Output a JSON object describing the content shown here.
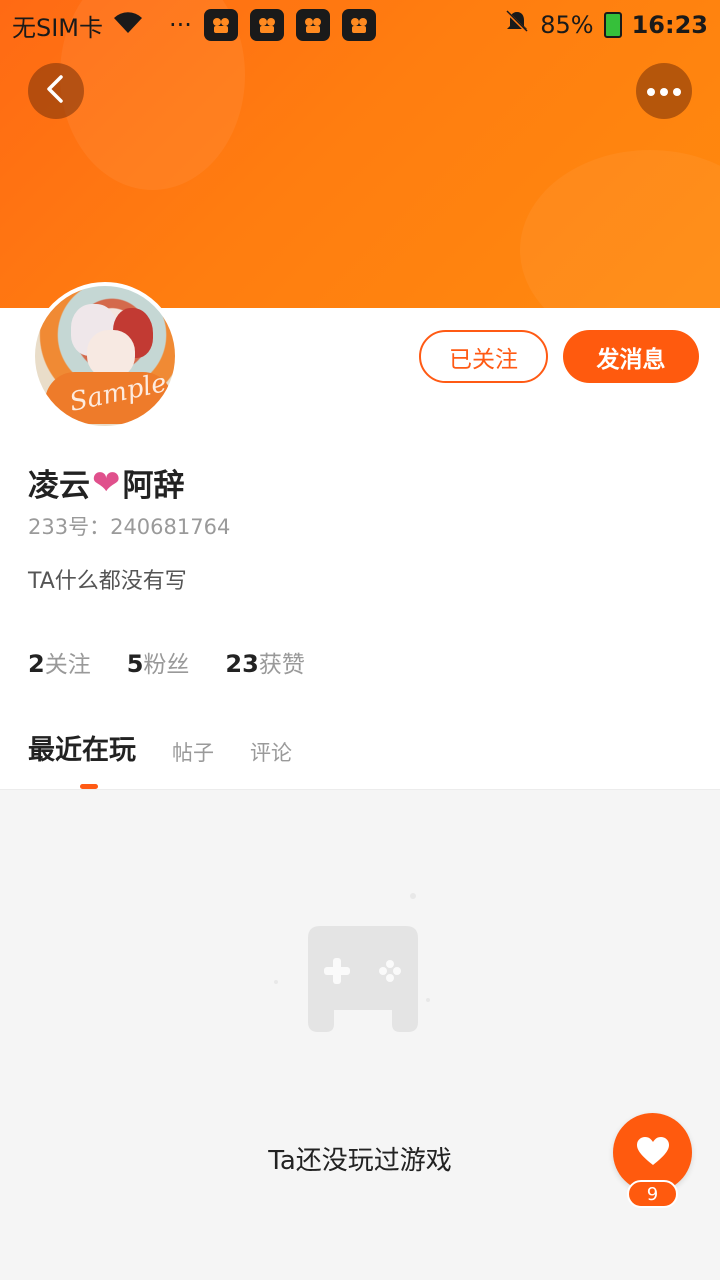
{
  "status_bar": {
    "carrier": "无SIM卡",
    "more": "···",
    "battery": "85%",
    "time": "16:23",
    "app_badge_count": 4
  },
  "header": {
    "back_icon": "chevron-left-icon",
    "more_icon": "more-dots-icon",
    "accent_color": "#ff6a14"
  },
  "profile": {
    "name_part1": "凌云",
    "name_heart": "❤",
    "name_part2": "阿辞",
    "uid": "233号：240681764",
    "bio": "TA什么都没有写",
    "avatar_watermark": "Sample",
    "follow_label": "已关注",
    "message_label": "发消息"
  },
  "stats": [
    {
      "num": "2",
      "label": "关注"
    },
    {
      "num": "5",
      "label": "粉丝"
    },
    {
      "num": "23",
      "label": "获赞"
    }
  ],
  "tabs": [
    {
      "label": "最近在玩",
      "active": true
    },
    {
      "label": "帖子",
      "active": false
    },
    {
      "label": "评论",
      "active": false
    }
  ],
  "empty_state": {
    "icon": "gamepad-icon",
    "text": "Ta还没玩过游戏"
  },
  "like_fab": {
    "icon": "heart-icon",
    "count": "9"
  }
}
